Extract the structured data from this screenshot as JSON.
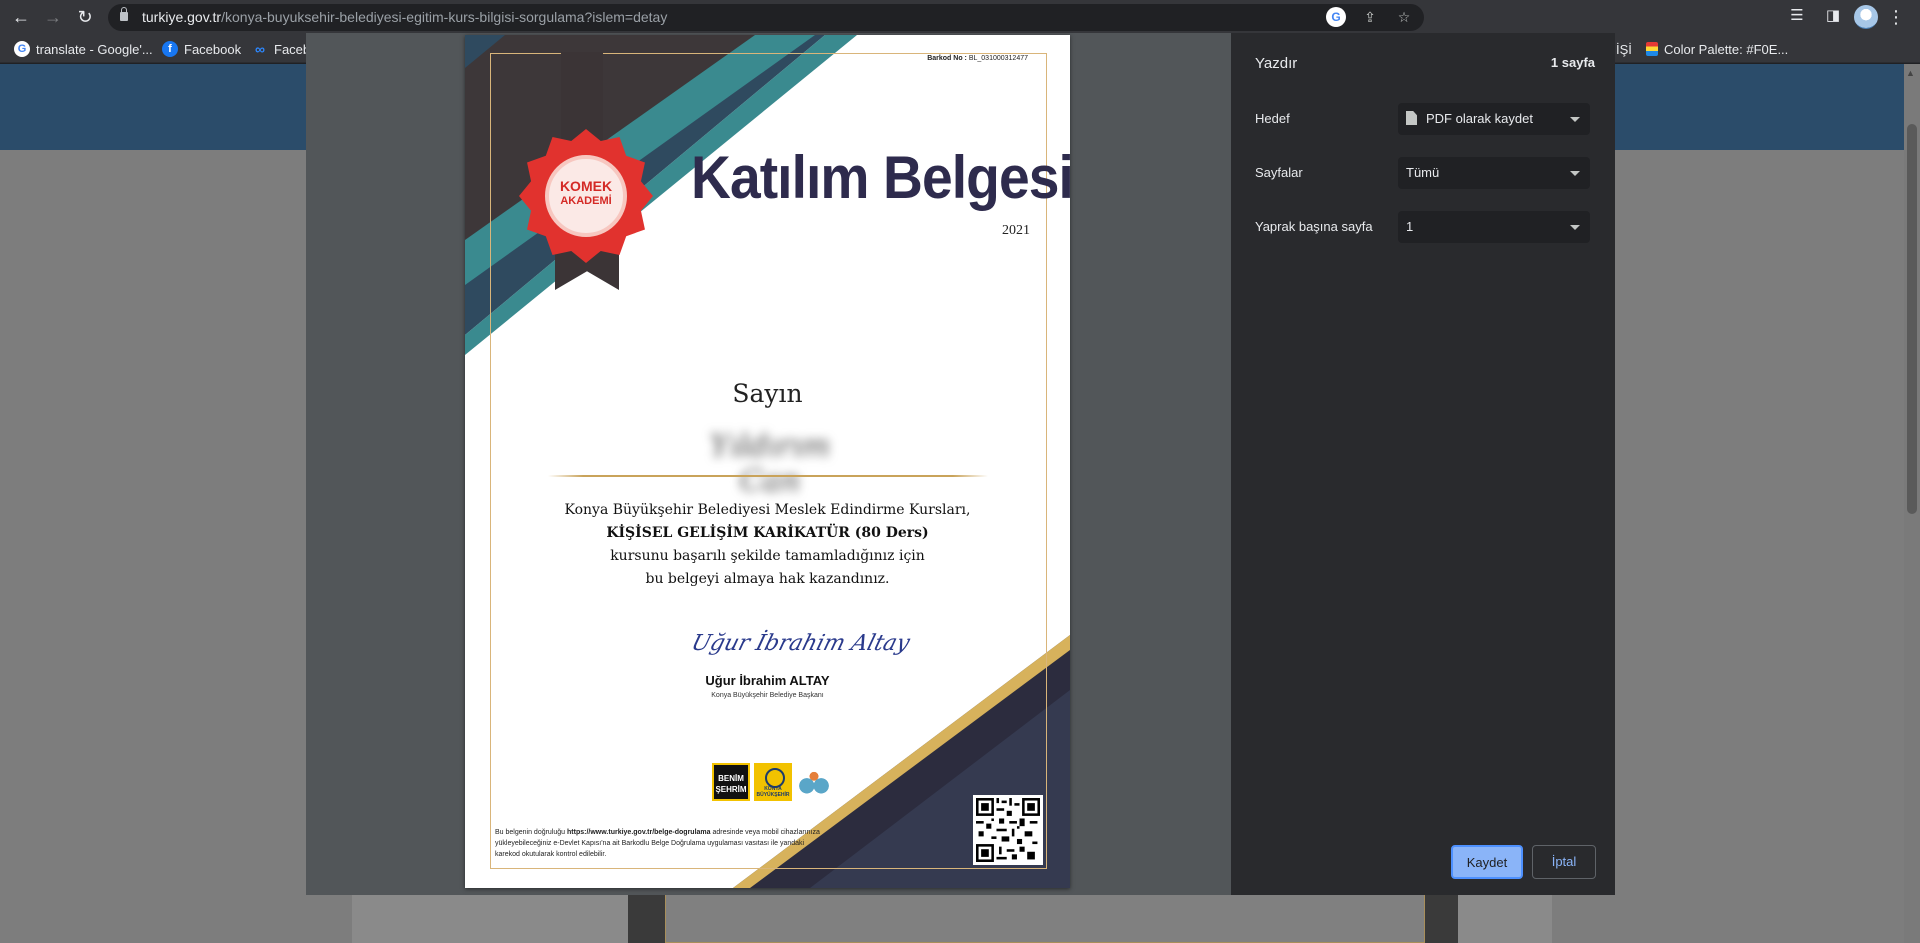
{
  "browser": {
    "url_host": "turkiye.gov.tr",
    "url_path": "/konya-buyuksehir-belediyesi-egitim-kurs-bilgisi-sorgulama?islem=detay",
    "bookmarks": [
      {
        "label": "translate - Google'...",
        "icon": "google-icon"
      },
      {
        "label": "Facebook",
        "icon": "facebook-icon"
      },
      {
        "label": "Faceb",
        "icon": "meta-icon"
      },
      {
        "label": "İŞİ",
        "icon": ""
      },
      {
        "label": "Color Palette: #F0E...",
        "icon": "palette-icon"
      }
    ]
  },
  "print_dialog": {
    "title": "Yazdır",
    "page_count": "1 sayfa",
    "destination_label": "Hedef",
    "destination_value": "PDF olarak kaydet",
    "pages_label": "Sayfalar",
    "pages_value": "Tümü",
    "pages_per_sheet_label": "Yaprak başına sayfa",
    "pages_per_sheet_value": "1",
    "save_button": "Kaydet",
    "cancel_button": "İptal"
  },
  "certificate": {
    "barcode_label": "Barkod No :",
    "barcode_value": "BL_031000312477",
    "seal_line1": "KOMEK",
    "seal_line2": "AKADEMİ",
    "title": "Katılım Belgesi",
    "year": "2021",
    "salutation": "Sayın",
    "recipient_name": "Yıldırım Can",
    "line1": "Konya Büyükşehir Belediyesi Meslek Edindirme Kursları,",
    "course": "KİŞİSEL GELİŞİM KARİKATÜR (80 Ders)",
    "line3": "kursunu başarılı şekilde tamamladığınız için",
    "line4": "bu belgeyi almaya hak kazandınız.",
    "signature": "Uğur İbrahim Altay",
    "signer_name": "Uğur İbrahim ALTAY",
    "signer_title": "Konya Büyükşehir Belediye Başkanı",
    "logo1_line1": "BENİM",
    "logo1_line2": "ŞEHRİM",
    "logo2_line1": "KONYA",
    "logo2_line2": "BÜYÜKŞEHİR",
    "footer_prefix": "Bu belgenin doğruluğu",
    "footer_url": "https://www.turkiye.gov.tr/belge-dogrulama",
    "footer_suffix": "adresinde veya mobil cihazlarınıza yükleyebileceğiniz e-Devlet Kapısı'na ait Barkodlu Belge Doğrulama uygulaması vasıtası ile yandaki karekod okutularak kontrol edilebilir."
  }
}
